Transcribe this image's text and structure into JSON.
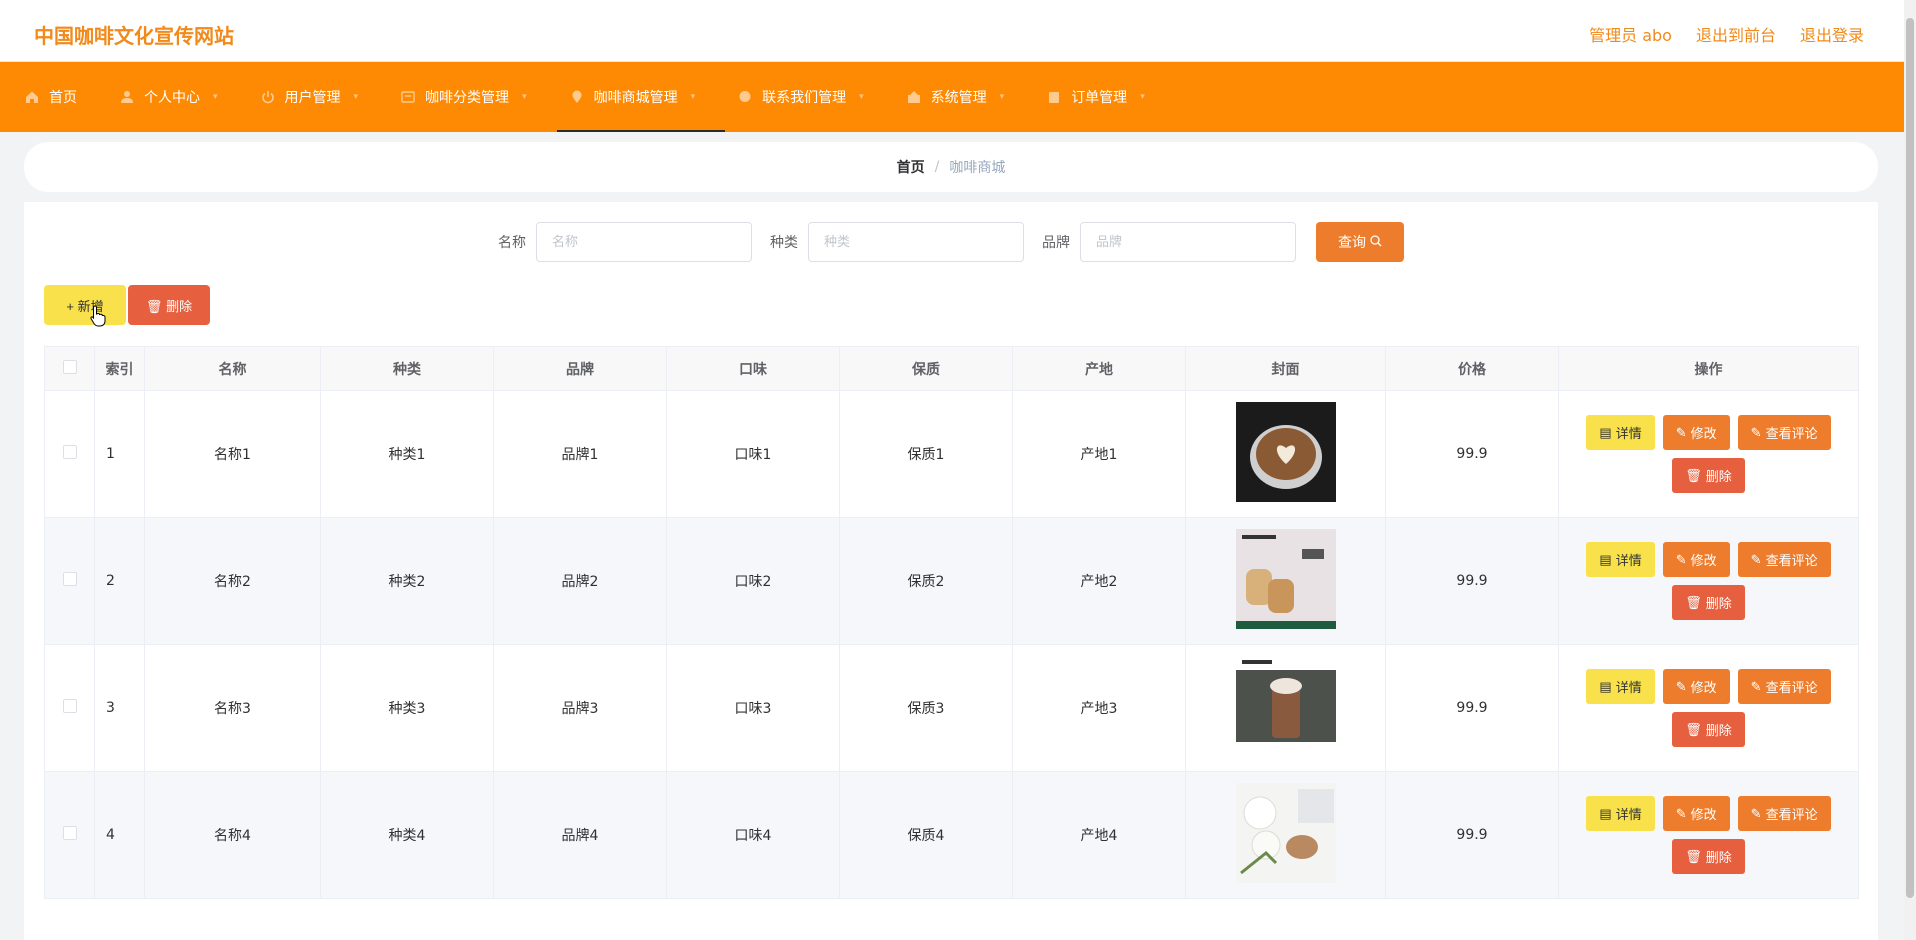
{
  "header": {
    "site_title": "中国咖啡文化宣传网站",
    "admin_label": "管理员 abo",
    "to_front_label": "退出到前台",
    "logout_label": "退出登录"
  },
  "nav": {
    "items": [
      {
        "label": "首页",
        "icon": "home-icon"
      },
      {
        "label": "个人中心",
        "icon": "user-icon"
      },
      {
        "label": "用户管理",
        "icon": "power-icon"
      },
      {
        "label": "咖啡分类管理",
        "icon": "tag-icon"
      },
      {
        "label": "咖啡商城管理",
        "icon": "location-icon"
      },
      {
        "label": "联系我们管理",
        "icon": "chat-icon"
      },
      {
        "label": "系统管理",
        "icon": "system-icon"
      },
      {
        "label": "订单管理",
        "icon": "clipboard-icon"
      }
    ]
  },
  "breadcrumb": {
    "home": "首页",
    "separator": "/",
    "current": "咖啡商城"
  },
  "search": {
    "name_label": "名称",
    "name_placeholder": "名称",
    "type_label": "种类",
    "type_placeholder": "种类",
    "brand_label": "品牌",
    "brand_placeholder": "品牌",
    "button_label": "查询"
  },
  "actions": {
    "add_label": "+ 新增",
    "delete_label": "删除"
  },
  "table": {
    "headers": [
      "索引",
      "名称",
      "种类",
      "品牌",
      "口味",
      "保质",
      "产地",
      "封面",
      "价格",
      "操作"
    ],
    "rows": [
      {
        "index": "1",
        "name": "名称1",
        "type": "种类1",
        "brand": "品牌1",
        "taste": "口味1",
        "shelf": "保质1",
        "origin": "产地1",
        "price": "99.9"
      },
      {
        "index": "2",
        "name": "名称2",
        "type": "种类2",
        "brand": "品牌2",
        "taste": "口味2",
        "shelf": "保质2",
        "origin": "产地2",
        "price": "99.9"
      },
      {
        "index": "3",
        "name": "名称3",
        "type": "种类3",
        "brand": "品牌3",
        "taste": "口味3",
        "shelf": "保质3",
        "origin": "产地3",
        "price": "99.9"
      },
      {
        "index": "4",
        "name": "名称4",
        "type": "种类4",
        "brand": "品牌4",
        "taste": "口味4",
        "shelf": "保质4",
        "origin": "产地4",
        "price": "99.9"
      }
    ],
    "ops": {
      "detail": "详情",
      "edit": "修改",
      "review": "查看评论",
      "remove": "删除"
    }
  },
  "colors": {
    "nav_bg": "#fe8a04",
    "accent": "#ed7d2c",
    "yellow": "#f8e14a",
    "danger": "#e6603f"
  }
}
